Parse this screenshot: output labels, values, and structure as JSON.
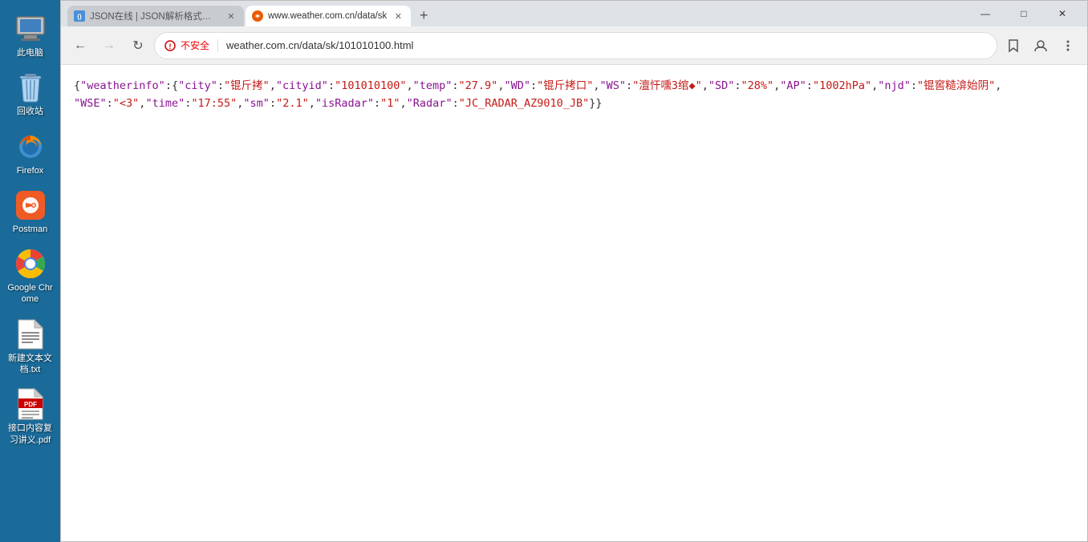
{
  "desktop": {
    "background_color": "#1a6b9a",
    "icons": [
      {
        "id": "this-computer",
        "label": "此电脑",
        "type": "computer"
      },
      {
        "id": "recycle-bin",
        "label": "回收站",
        "type": "recycle"
      },
      {
        "id": "firefox",
        "label": "Firefox",
        "type": "firefox"
      },
      {
        "id": "postman",
        "label": "Postman",
        "type": "postman"
      },
      {
        "id": "google-chrome",
        "label": "Google Chrome",
        "type": "chrome"
      },
      {
        "id": "new-text-file",
        "label": "新建文本文\n档.txt",
        "type": "textfile"
      },
      {
        "id": "interface-notes",
        "label": "接口内容复\n习讲义.pdf",
        "type": "pdffile"
      }
    ]
  },
  "browser": {
    "tabs": [
      {
        "id": "tab-json",
        "label": "JSON在线 | JSON解析格式化—",
        "active": true,
        "favicon": "json"
      },
      {
        "id": "tab-weather",
        "label": "www.weather.com.cn/data/sk",
        "active": false,
        "favicon": "weather"
      }
    ],
    "new_tab_label": "+",
    "window_controls": {
      "minimize": "—",
      "maximize": "□",
      "close": "✕"
    },
    "toolbar": {
      "back_disabled": false,
      "forward_disabled": true,
      "refresh": true,
      "security_label": "不安全",
      "address": "weather.com.cn/data/sk/101010100.html"
    },
    "page": {
      "content": "{\"weatherinfo\":{\"city\":\"锟斤拷\",\"cityid\":\"101010100\",\"temp\":\"27.9\",\"WD\":\"锟斤拷口\",\"WS\":\"澶忓嚑3绾◆\",\"SD\":\"28%\",\"AP\":\"1002hPa\",\"njd\":\"锟窖糙渰始阴\",\"WSE\":\"<3\",\"time\":\"17:55\",\"sm\":\"2.1\",\"isRadar\":\"1\",\"Radar\":\"JC_RADAR_AZ9010_JB\"}}"
    }
  }
}
